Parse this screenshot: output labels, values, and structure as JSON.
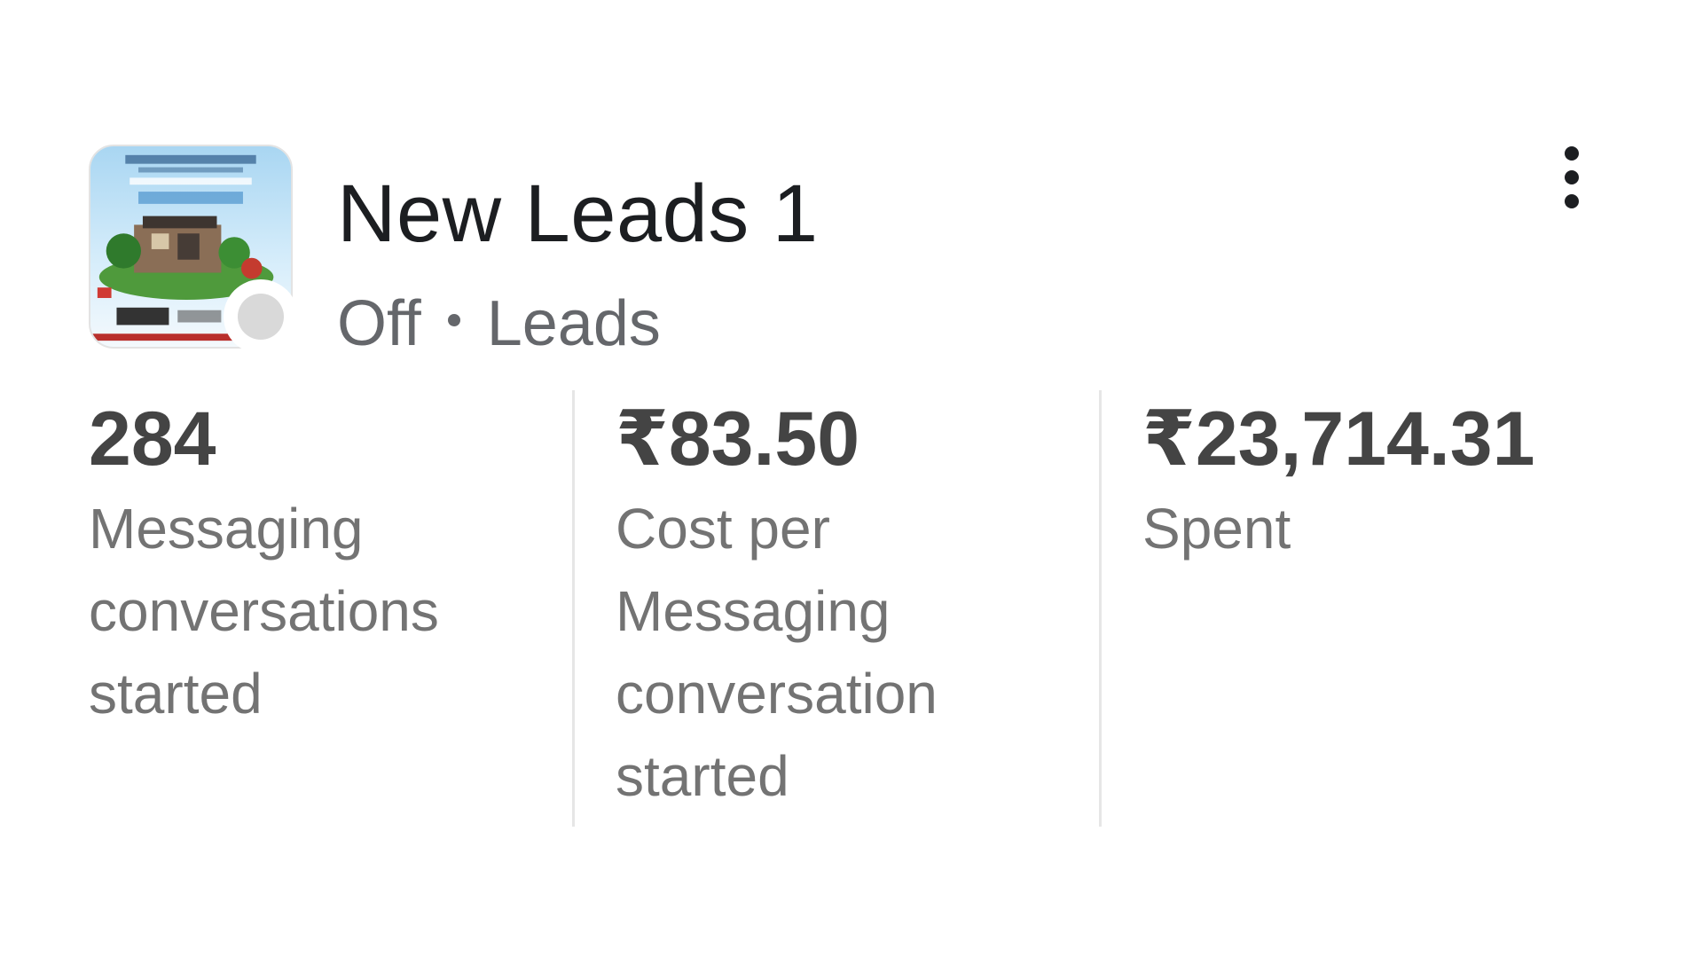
{
  "ad": {
    "title": "New Leads 1",
    "status": "Off",
    "objective": "Leads",
    "status_color": "#d9d9d9"
  },
  "metrics": [
    {
      "value": "284",
      "label": "Messaging conversations started"
    },
    {
      "value": "₹83.50",
      "label": "Cost per Messaging conversation started"
    },
    {
      "value": "₹23,714.31",
      "label": "Spent"
    }
  ],
  "icons": {
    "more": "more-vertical-icon",
    "thumbnail": "ad-creative-thumbnail"
  }
}
